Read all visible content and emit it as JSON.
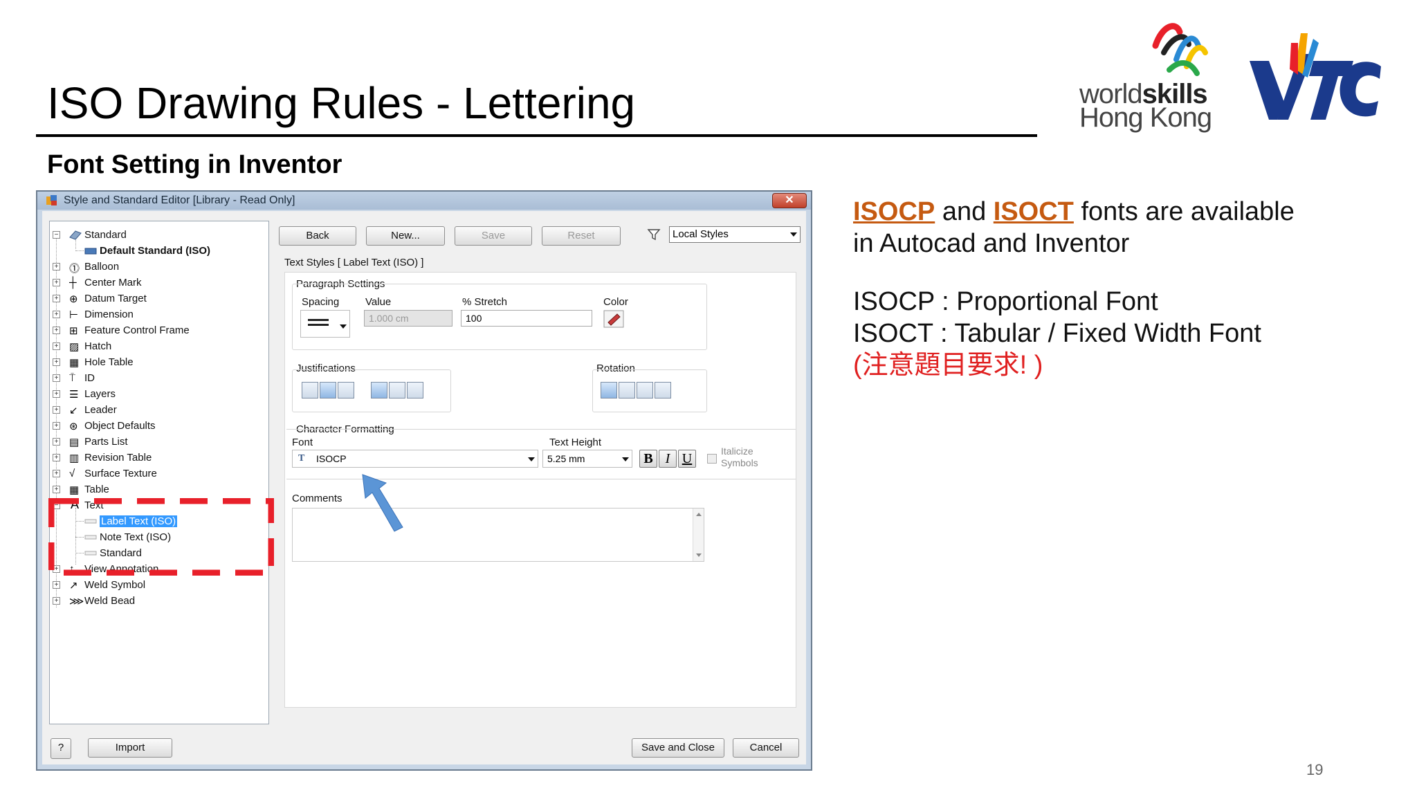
{
  "slide": {
    "title": "ISO Drawing Rules - Lettering",
    "subtitle": "Font Setting in Inventor",
    "page_number": "19"
  },
  "logos": {
    "worldskills_line1_light": "world",
    "worldskills_line1_bold": "skills",
    "worldskills_line2": "Hong Kong"
  },
  "info": {
    "kw1": "ISOCP",
    "and": "and",
    "kw2": "ISOCT",
    "line1_rest": "fonts are available",
    "line2": "in Autocad and Inventor",
    "line3": "ISOCP : Proportional Font",
    "line4": "ISOCT : Tabular / Fixed Width Font",
    "line5": "(注意題目要求! )"
  },
  "dialog": {
    "title": "Style and Standard Editor [Library - Read Only]",
    "close_label": "✕",
    "toolbar": {
      "back": "Back",
      "new": "New...",
      "save": "Save",
      "reset": "Reset",
      "styles_filter": "Local Styles"
    },
    "breadcrumb": "Text Styles [ Label Text (ISO) ]",
    "tree": {
      "standard": "Standard",
      "default_standard": "Default Standard (ISO)",
      "items": [
        "Balloon",
        "Center Mark",
        "Datum Target",
        "Dimension",
        "Feature Control Frame",
        "Hatch",
        "Hole Table",
        "ID",
        "Layers",
        "Leader",
        "Object Defaults",
        "Parts List",
        "Revision Table",
        "Surface Texture",
        "Table"
      ],
      "text": "Text",
      "text_children": [
        "Label Text (ISO)",
        "Note Text (ISO)",
        "Standard"
      ],
      "tail_items": [
        "View Annotation",
        "Weld Symbol",
        "Weld Bead"
      ]
    },
    "paragraph": {
      "group_label": "Paragraph Settings",
      "spacing_label": "Spacing",
      "value_label": "Value",
      "value": "1.000 cm",
      "stretch_label": "% Stretch",
      "stretch": "100",
      "color_label": "Color"
    },
    "justifications_label": "Justifications",
    "rotation_label": "Rotation",
    "character": {
      "group_label": "Character Formatting",
      "font_label": "Font",
      "font_value": "ISOCP",
      "height_label": "Text Height",
      "height_value": "5.25 mm",
      "bold": "B",
      "italic": "I",
      "underline": "U",
      "italicize_line1": "Italicize",
      "italicize_line2": "Symbols"
    },
    "comments_label": "Comments",
    "footer": {
      "help": "?",
      "import": "Import",
      "save_close": "Save and Close",
      "cancel": "Cancel"
    }
  },
  "colors": {
    "keyword": "#c55a11",
    "note": "#e02020",
    "highlight_dash": "#e8202a",
    "arrow": "#4a90d9",
    "selection": "#3399ff"
  }
}
